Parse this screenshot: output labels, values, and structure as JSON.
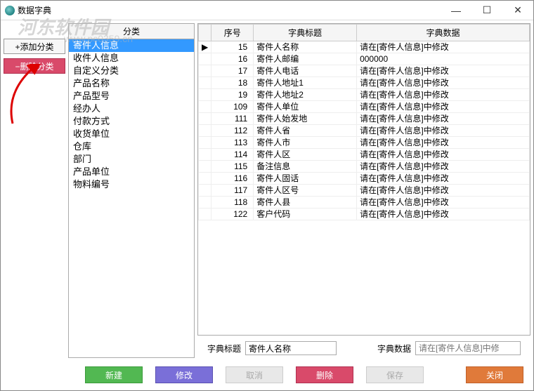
{
  "window": {
    "title": "数据字典"
  },
  "watermark": {
    "text": "河东软件园",
    "url": "www.pc0359.cn"
  },
  "sidebar": {
    "add_label": "+添加分类",
    "delete_label": "−删除分类"
  },
  "categories": {
    "header": "分类",
    "items": [
      "寄件人信息",
      "收件人信息",
      "自定义分类",
      "产品名称",
      "产品型号",
      "经办人",
      "付款方式",
      "收货单位",
      "仓库",
      "部门",
      "产品单位",
      "物料编号"
    ],
    "selected_index": 0
  },
  "table": {
    "columns": [
      "",
      "序号",
      "字典标题",
      "字典数据"
    ],
    "rows": [
      {
        "marker": "▶",
        "idx": 15,
        "title": "寄件人名称",
        "data": "请在[寄件人信息]中修改"
      },
      {
        "marker": "",
        "idx": 16,
        "title": "寄件人邮编",
        "data": "000000"
      },
      {
        "marker": "",
        "idx": 17,
        "title": "寄件人电话",
        "data": "请在[寄件人信息]中修改"
      },
      {
        "marker": "",
        "idx": 18,
        "title": "寄件人地址1",
        "data": "请在[寄件人信息]中修改"
      },
      {
        "marker": "",
        "idx": 19,
        "title": "寄件人地址2",
        "data": "请在[寄件人信息]中修改"
      },
      {
        "marker": "",
        "idx": 109,
        "title": "寄件人单位",
        "data": "请在[寄件人信息]中修改"
      },
      {
        "marker": "",
        "idx": 111,
        "title": "寄件人始发地",
        "data": "请在[寄件人信息]中修改"
      },
      {
        "marker": "",
        "idx": 112,
        "title": "寄件人省",
        "data": "请在[寄件人信息]中修改"
      },
      {
        "marker": "",
        "idx": 113,
        "title": "寄件人市",
        "data": "请在[寄件人信息]中修改"
      },
      {
        "marker": "",
        "idx": 114,
        "title": "寄件人区",
        "data": "请在[寄件人信息]中修改"
      },
      {
        "marker": "",
        "idx": 115,
        "title": "备注信息",
        "data": "请在[寄件人信息]中修改"
      },
      {
        "marker": "",
        "idx": 116,
        "title": "寄件人固话",
        "data": "请在[寄件人信息]中修改"
      },
      {
        "marker": "",
        "idx": 117,
        "title": "寄件人区号",
        "data": "请在[寄件人信息]中修改"
      },
      {
        "marker": "",
        "idx": 118,
        "title": "寄件人县",
        "data": "请在[寄件人信息]中修改"
      },
      {
        "marker": "",
        "idx": 122,
        "title": "客户代码",
        "data": "请在[寄件人信息]中修改"
      }
    ]
  },
  "form": {
    "title_label": "字典标题",
    "title_value": "寄件人名称",
    "data_label": "字典数据",
    "data_placeholder": "请在[寄件人信息]中修"
  },
  "buttons": {
    "new": "新建",
    "edit": "修改",
    "cancel": "取消",
    "delete": "删除",
    "save": "保存",
    "close": "关闭"
  }
}
